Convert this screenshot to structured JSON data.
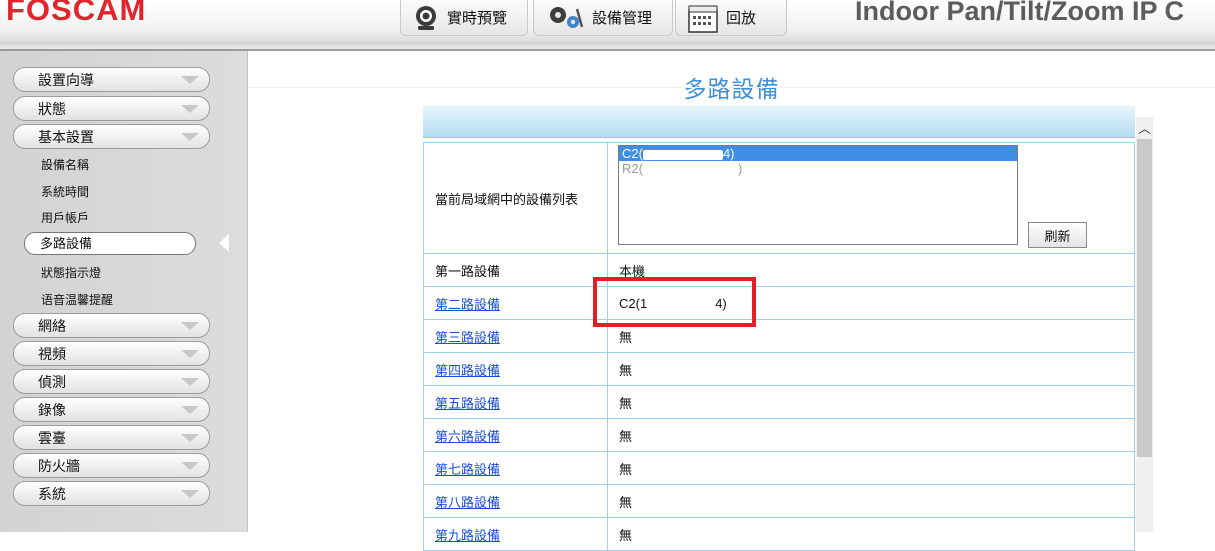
{
  "header": {
    "logo": "FOSCAM",
    "product_title": "Indoor Pan/Tilt/Zoom IP C",
    "tabs": [
      {
        "label": "實時預覽",
        "icon": "camera-icon"
      },
      {
        "label": "設備管理",
        "icon": "gears-icon"
      },
      {
        "label": "回放",
        "icon": "calendar-icon"
      }
    ]
  },
  "sidebar": {
    "top_menus": [
      "設置向導",
      "狀態",
      "基本設置"
    ],
    "sub_items": [
      "設備名稱",
      "系統時間",
      "用戶帳戶"
    ],
    "active_item": "多路設備",
    "sub_items_after": [
      "狀態指示燈",
      "语音温馨提醒"
    ],
    "bottom_menus": [
      "網絡",
      "視頻",
      "偵測",
      "錄像",
      "雲臺",
      "防火牆",
      "系統"
    ]
  },
  "main": {
    "title": "多路設備",
    "device_list_label": "當前局域網中的設備列表",
    "device_list": [
      {
        "prefix": "C2(",
        "suffix": "4)"
      },
      {
        "prefix": "R2(",
        "suffix": ")"
      }
    ],
    "refresh_label": "刷新",
    "rows": [
      {
        "label": "第一路設備",
        "value": "本機",
        "link": false
      },
      {
        "label": "第二路設備",
        "value_prefix": "C2(1",
        "value_suffix": "4)",
        "link": true
      },
      {
        "label": "第三路設備",
        "value": "無",
        "link": true
      },
      {
        "label": "第四路設備",
        "value": "無",
        "link": true
      },
      {
        "label": "第五路設備",
        "value": "無",
        "link": true
      },
      {
        "label": "第六路設備",
        "value": "無",
        "link": true
      },
      {
        "label": "第七路設備",
        "value": "無",
        "link": true
      },
      {
        "label": "第八路設備",
        "value": "無",
        "link": true
      },
      {
        "label": "第九路設備",
        "value": "無",
        "link": true
      }
    ]
  },
  "colors": {
    "logo_red": "#e1252c",
    "title_blue": "#3f8ed6",
    "link_blue": "#1a4ed8",
    "highlight_red": "#e11f26",
    "selection_blue": "#3d8ee6"
  }
}
